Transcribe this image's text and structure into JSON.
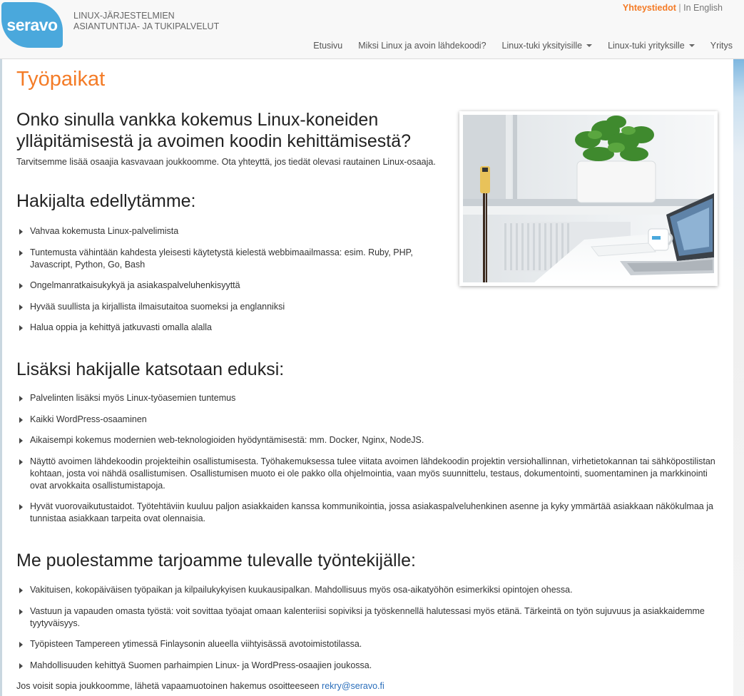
{
  "header": {
    "logo_text": "seravo",
    "tagline_line1": "LINUX-JÄRJESTELMIEN",
    "tagline_line2": "ASIANTUNTIJA- JA TUKIPALVELUT",
    "contact_link": "Yhteystiedot",
    "separator": "|",
    "english_link": "In English",
    "brand_color": "#4aa8dc",
    "accent_color": "#f47b26",
    "nav": [
      {
        "label": "Etusivu",
        "dropdown": false
      },
      {
        "label": "Miksi Linux ja avoin lähdekoodi?",
        "dropdown": false
      },
      {
        "label": "Linux-tuki yksityisille",
        "dropdown": true
      },
      {
        "label": "Linux-tuki yrityksille",
        "dropdown": true
      },
      {
        "label": "Yritys",
        "dropdown": false
      }
    ]
  },
  "main": {
    "page_title": "Työpaikat",
    "intro_title": "Onko sinulla vankka kokemus Linux-koneiden ylläpitämisestä ja avoimen koodin kehittämisestä?",
    "intro_text": "Tarvitsemme lisää osaajia kasvavaan joukkoomme. Ota yhteyttä, jos tiedät olevasi rautainen Linux-osaaja.",
    "requirements_title": "Hakijalta edellytämme:",
    "requirements": [
      "Vahvaa kokemusta Linux-palvelimista",
      "Tuntemusta vähintään kahdesta yleisesti käytetystä kielestä webbimaailmassa: esim. Ruby, PHP, Javascript, Python, Go, Bash",
      "Ongelmanratkaisukykyä ja asiakaspalveluhenkisyyttä",
      "Hyvää suullista ja kirjallista ilmaisutaitoa suomeksi ja englanniksi",
      "Halua oppia ja kehittyä jatkuvasti omalla alalla"
    ],
    "bonus_title": "Lisäksi hakijalle katsotaan eduksi:",
    "bonus": [
      "Palvelinten lisäksi myös Linux-työasemien tuntemus",
      "Kaikki WordPress-osaaminen",
      "Aikaisempi kokemus modernien web-teknologioiden hyödyntämisestä: mm. Docker, Nginx, NodeJS.",
      "Näyttö avoimen lähdekoodin projekteihin osallistumisesta. Työhakemuksessa tulee viitata avoimen lähdekoodin projektin versiohallinnan, virhetietokannan tai sähköpostilistan kohtaan, josta voi nähdä osallistumisen. Osallistumisen muoto ei ole pakko olla ohjelmointia, vaan myös suunnittelu, testaus, dokumentointi, suomentaminen ja markkinointi ovat arvokkaita osallistumistapoja.",
      "Hyvät vuorovaikutustaidot. Työtehtäviin kuuluu paljon asiakkaiden kanssa kommunikointia, jossa asiakaspalveluhenkinen asenne ja kyky ymmärtää asiakkaan näkökulmaa ja tunnistaa asiakkaan tarpeita ovat olennaisia."
    ],
    "offer_title": "Me puolestamme tarjoamme tulevalle työntekijälle:",
    "offer": [
      "Vakituisen, kokopäiväisen työpaikan ja kilpailukykyisen kuukausipalkan. Mahdollisuus myös osa-aikatyöhön esimerkiksi opintojen ohessa.",
      "Vastuun ja vapauden omasta työstä: voit sovittaa työajat omaan kalenteriisi sopiviksi ja työskennellä halutessasi myös etänä. Tärkeintä on työn sujuvuus ja asiakkaidemme tyytyväisyys.",
      "Työpisteen Tampereen ytimessä Finlaysonin alueella viihtyisässä avotoimistotilassa.",
      "Mahdollisuuden kehittyä Suomen parhaimpien Linux- ja WordPress-osaajien joukossa."
    ],
    "footer_text": "Jos voisit sopia joukkoomme, lähetä vapaamuotoinen hakemus osoitteeseen",
    "footer_email": "rekry@seravo.fi"
  }
}
